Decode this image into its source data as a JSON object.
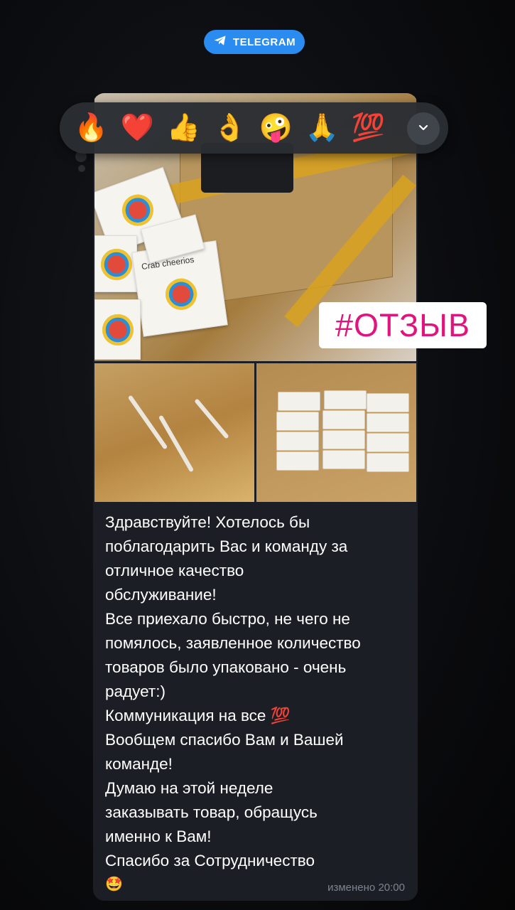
{
  "badge": {
    "label": "TELEGRAM"
  },
  "reactions": [
    {
      "emoji": "🔥",
      "name": "fire"
    },
    {
      "emoji": "❤️",
      "name": "heart"
    },
    {
      "emoji": "👍",
      "name": "thumbs-up"
    },
    {
      "emoji": "👌",
      "name": "ok-hand"
    },
    {
      "emoji": "🤪",
      "name": "zany-face"
    },
    {
      "emoji": "🙏",
      "name": "folded-hands"
    },
    {
      "emoji": "💯",
      "name": "hundred"
    }
  ],
  "review_tag": "#ОТЗЫВ",
  "message": {
    "lines": [
      "Здравствуйте! Хотелось бы",
      "поблагодарить Вас и команду за",
      "отличное качество",
      "обслуживание!",
      "Все приехало быстро, не чего не",
      "помялось, заявленное количество",
      "товаров было упаковано - очень",
      "радует:)",
      "Коммуникация на все 💯",
      "Вообщем спасибо Вам и Вашей",
      "команде!",
      "Думаю на этой неделе",
      "заказывать товар, обращусь",
      "именно к Вам!",
      "Спасибо за Сотрудничество"
    ],
    "trailing_emoji": "🤩",
    "edited_label": "изменено",
    "time": "20:00"
  },
  "photos": {
    "main_product_label": "Crab cheerios"
  },
  "colors": {
    "badge": "#2a8cf0",
    "review_tag_text": "#e0147c",
    "bubble": "#1b1f25"
  }
}
